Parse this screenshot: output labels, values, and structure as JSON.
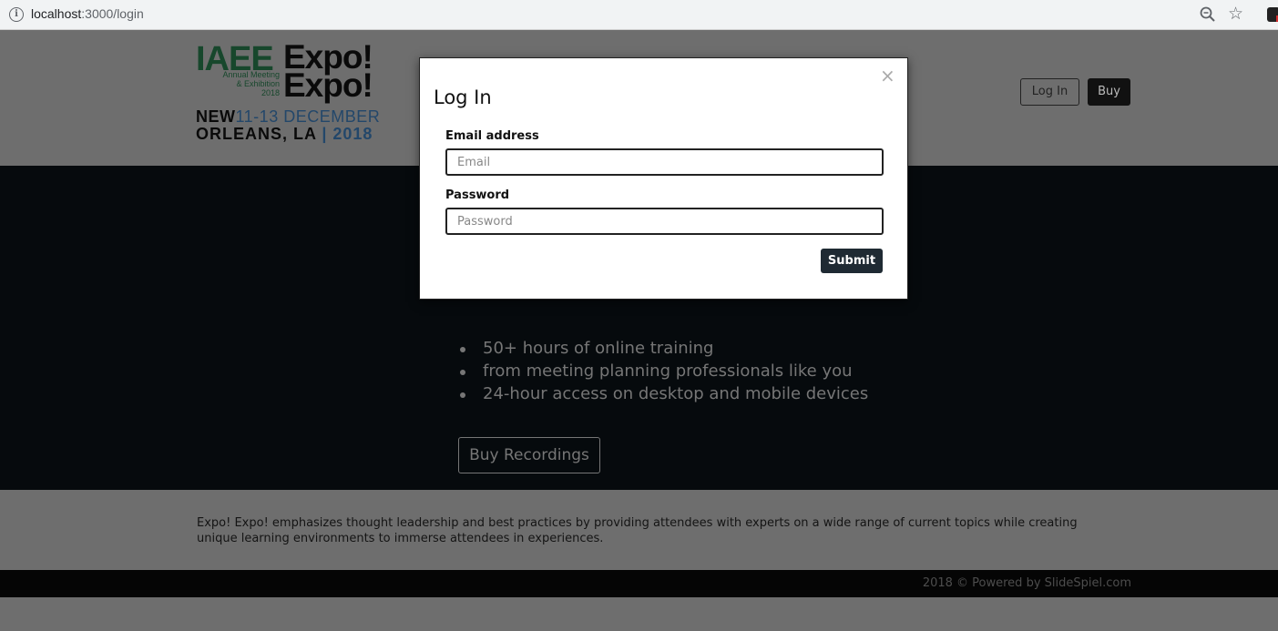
{
  "browser": {
    "url_host": "localhost",
    "url_path": ":3000/login"
  },
  "header": {
    "logo": {
      "iaee": "IAEE",
      "expo_1": "Expo!",
      "expo_2": "Expo!",
      "annual": [
        "Annual Meeting",
        "& Exhibition",
        "2018"
      ],
      "city_1": "NEW",
      "dates": "11-13 DECEMBER",
      "city_2": "ORLEANS, LA",
      "year": "| 2018"
    },
    "login_label": "Log In",
    "buy_label": "Buy"
  },
  "hero": {
    "features": [
      "50+ hours of online training",
      "from meeting planning professionals like you",
      "24-hour access on desktop and mobile devices"
    ],
    "buy_recordings_label": "Buy Recordings"
  },
  "about": {
    "text": "Expo! Expo! emphasizes thought leadership and best practices by providing attendees with experts on a wide range of current topics while creating unique learning environments to immerse attendees in experiences."
  },
  "footer": {
    "text": "2018 © Powered by SlideSpiel.com"
  },
  "modal": {
    "close_symbol": "×",
    "title": "Log In",
    "email_label": "Email address",
    "email_placeholder": "Email",
    "email_value": "",
    "password_label": "Password",
    "password_placeholder": "Password",
    "password_value": "",
    "submit_label": "Submit"
  },
  "colors": {
    "modal_bg": "#ffffff",
    "overlay_dim": "#6e6e6e",
    "hero_bg": "#060a0d",
    "submit_bg": "#1f2a33"
  }
}
